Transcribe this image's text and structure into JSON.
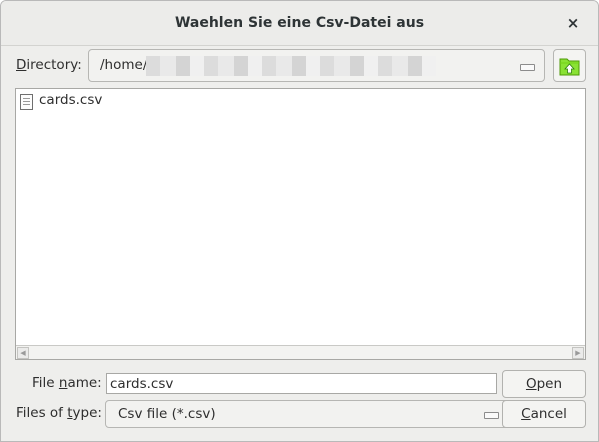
{
  "dialog": {
    "title": "Waehlen Sie eine Csv-Datei aus",
    "close_glyph": "×"
  },
  "directory": {
    "label_mnemonic": "D",
    "label_rest": "irectory:",
    "path_visible": "/home/",
    "up_icon": "folder-up-icon"
  },
  "files": [
    {
      "name": "cards.csv",
      "icon": "document-icon"
    }
  ],
  "file_name": {
    "label_pre": "File ",
    "label_mnemonic": "n",
    "label_post": "ame:",
    "value": "cards.csv"
  },
  "files_of_type": {
    "label_pre": "Files of ",
    "label_mnemonic": "t",
    "label_post": "ype:",
    "value": "Csv file (*.csv)"
  },
  "buttons": {
    "open": {
      "mnemonic": "O",
      "rest": "pen"
    },
    "cancel": {
      "mnemonic": "C",
      "rest": "ancel"
    }
  },
  "colors": {
    "window_bg": "#eeeeec",
    "list_bg": "#ffffff",
    "folder_icon": "#4e9a06"
  }
}
